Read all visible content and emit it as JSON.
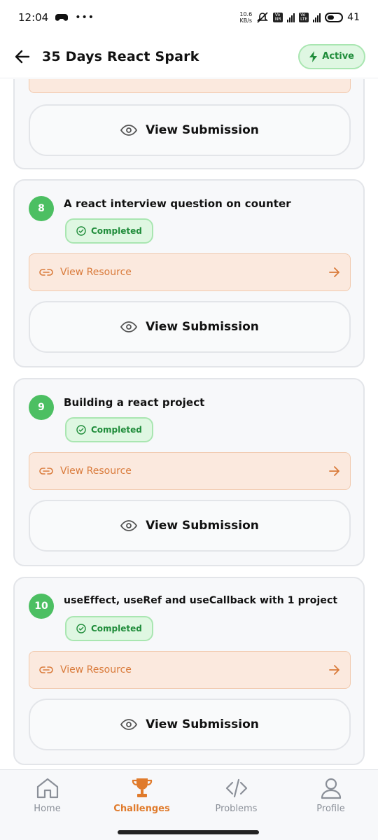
{
  "status_bar": {
    "time": "12:04",
    "net_speed_value": "10.6",
    "net_speed_unit": "KB/s",
    "battery": "41"
  },
  "header": {
    "title": "35 Days React Spark",
    "badge": "Active"
  },
  "common": {
    "view_resource": "View Resource",
    "view_submission": "View Submission",
    "completed": "Completed"
  },
  "tasks": [
    {
      "number": "8",
      "title": "A react interview question on counter",
      "status": "Completed"
    },
    {
      "number": "9",
      "title": "Building a react project",
      "status": "Completed"
    },
    {
      "number": "10",
      "title": "useEffect, useRef and useCallback with 1 project",
      "status": "Completed"
    }
  ],
  "nav": {
    "items": [
      {
        "label": "Home",
        "icon": "home-icon"
      },
      {
        "label": "Challenges",
        "icon": "trophy-icon"
      },
      {
        "label": "Problems",
        "icon": "code-icon"
      },
      {
        "label": "Profile",
        "icon": "user-icon"
      }
    ],
    "active": "Challenges"
  },
  "colors": {
    "accent_green": "#4cbf62",
    "accent_orange": "#e07b2c",
    "resource_bg": "#fbe9de"
  }
}
